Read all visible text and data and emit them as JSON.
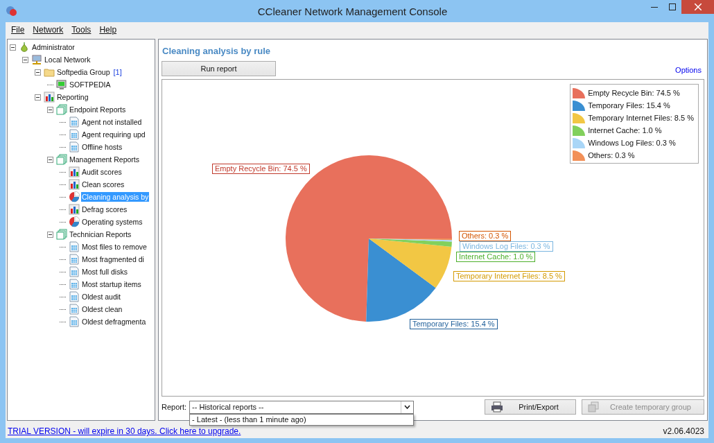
{
  "window": {
    "title": "CCleaner Network Management Console"
  },
  "menu": [
    "File",
    "Network",
    "Tools",
    "Help"
  ],
  "tree": [
    {
      "label": "Administrator",
      "kind": "pear",
      "expanded": true,
      "selected": false,
      "children": [
        {
          "label": "Local Network",
          "kind": "network",
          "expanded": true,
          "selected": false,
          "children": [
            {
              "label": "Softpedia Group",
              "count": "[1]",
              "kind": "folder",
              "expanded": true,
              "selected": false,
              "children": [
                {
                  "label": "SOFTPEDIA",
                  "kind": "computer",
                  "selected": false
                }
              ]
            },
            {
              "label": "Reporting",
              "kind": "bars",
              "expanded": true,
              "selected": false,
              "children": [
                {
                  "label": "Endpoint Reports",
                  "kind": "pages",
                  "expanded": true,
                  "selected": false,
                  "children": [
                    {
                      "label": "Agent not installed",
                      "kind": "sheet",
                      "selected": false
                    },
                    {
                      "label": "Agent requiring upd",
                      "kind": "sheet",
                      "selected": false
                    },
                    {
                      "label": "Offline hosts",
                      "kind": "sheet",
                      "selected": false
                    }
                  ]
                },
                {
                  "label": "Management Reports",
                  "kind": "pages",
                  "expanded": true,
                  "selected": false,
                  "children": [
                    {
                      "label": "Audit scores",
                      "kind": "bars",
                      "selected": false
                    },
                    {
                      "label": "Clean scores",
                      "kind": "bars",
                      "selected": false
                    },
                    {
                      "label": "Cleaning analysis by",
                      "kind": "pie",
                      "selected": true
                    },
                    {
                      "label": "Defrag scores",
                      "kind": "bars",
                      "selected": false
                    },
                    {
                      "label": "Operating systems",
                      "kind": "pie",
                      "selected": false
                    }
                  ]
                },
                {
                  "label": "Technician Reports",
                  "kind": "pages",
                  "expanded": true,
                  "selected": false,
                  "children": [
                    {
                      "label": "Most files to remove",
                      "kind": "sheet",
                      "selected": false
                    },
                    {
                      "label": "Most fragmented di",
                      "kind": "sheet",
                      "selected": false
                    },
                    {
                      "label": "Most full disks",
                      "kind": "sheet",
                      "selected": false
                    },
                    {
                      "label": "Most startup items",
                      "kind": "sheet",
                      "selected": false
                    },
                    {
                      "label": "Oldest audit",
                      "kind": "sheet",
                      "selected": false
                    },
                    {
                      "label": "Oldest clean",
                      "kind": "sheet",
                      "selected": false
                    },
                    {
                      "label": "Oldest defragmenta",
                      "kind": "sheet",
                      "selected": false
                    }
                  ]
                }
              ]
            }
          ]
        }
      ]
    }
  ],
  "report": {
    "title": "Cleaning analysis by rule",
    "run_button": "Run report",
    "options_link": "Options",
    "chart_data": {
      "type": "pie",
      "values": [
        74.5,
        15.4,
        8.5,
        1.0,
        0.3,
        0.3
      ]
    },
    "legend": [
      {
        "text": "Empty Recycle Bin: 74.5 %",
        "color": "#e8705c"
      },
      {
        "text": "Temporary Files: 15.4 %",
        "color": "#3a8fd2"
      },
      {
        "text": "Temporary Internet Files: 8.5 %",
        "color": "#f2c744"
      },
      {
        "text": "Internet Cache: 1.0 %",
        "color": "#82d05c"
      },
      {
        "text": "Windows Log Files: 0.3 %",
        "color": "#a9d6f7"
      },
      {
        "text": "Others: 0.3 %",
        "color": "#f29058"
      }
    ],
    "slice_labels": [
      {
        "text": "Empty Recycle Bin: 74.5 %",
        "color": "#c0392b"
      },
      {
        "text": "Others: 0.3 %",
        "color": "#d35400"
      },
      {
        "text": "Windows Log Files: 0.3 %",
        "color": "#7ab6e0"
      },
      {
        "text": "Internet Cache: 1.0 %",
        "color": "#4caf2a"
      },
      {
        "text": "Temporary Internet Files: 8.5 %",
        "color": "#d49a00"
      },
      {
        "text": "Temporary Files: 15.4 %",
        "color": "#1f5f99"
      }
    ],
    "report_label": "Report:",
    "report_select": "-- Historical reports --",
    "report_options": [
      "- Latest - (less than 1 minute ago)"
    ],
    "buttons": [
      {
        "label": "Print/Export",
        "kind": "print",
        "disabled": false
      },
      {
        "label": "Create temporary group",
        "kind": "group",
        "disabled": true
      }
    ]
  },
  "status": {
    "link": "TRIAL VERSION - will expire in 30 days. Click here to upgrade.",
    "version": "v2.06.4023"
  }
}
